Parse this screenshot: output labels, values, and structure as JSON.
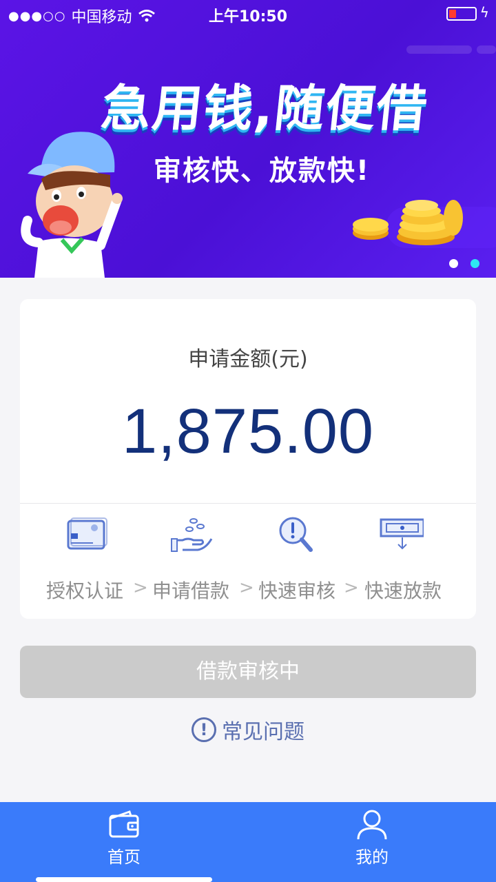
{
  "status_bar": {
    "signal_dots": "●●●○○",
    "carrier": "中国移动",
    "time": "上午10:50",
    "battery_color": "#ff3b30"
  },
  "banner": {
    "headline": "急用钱,随便借",
    "subline": "审核快、放款快!",
    "page_dots": 2,
    "active_dot": 2,
    "active_dot_color": "#2ee6f2"
  },
  "amount_card": {
    "label": "申请金额(元)",
    "amount": "1,875.00",
    "amount_color": "#13307a",
    "steps": [
      {
        "label": "授权认证",
        "icon": "card-icon"
      },
      {
        "label": "申请借款",
        "icon": "hand-coins-icon"
      },
      {
        "label": "快速审核",
        "icon": "magnifier-alert-icon"
      },
      {
        "label": "快速放款",
        "icon": "cash-download-icon"
      }
    ],
    "step_separator": ">"
  },
  "status_button": {
    "label": "借款审核中",
    "color": "#cbcbcb"
  },
  "faq": {
    "icon_glyph": "!",
    "label": "常见问题"
  },
  "tab_bar": {
    "color": "#3a7bfa",
    "tabs": [
      {
        "label": "首页",
        "icon": "wallet-icon"
      },
      {
        "label": "我的",
        "icon": "user-icon"
      }
    ]
  }
}
